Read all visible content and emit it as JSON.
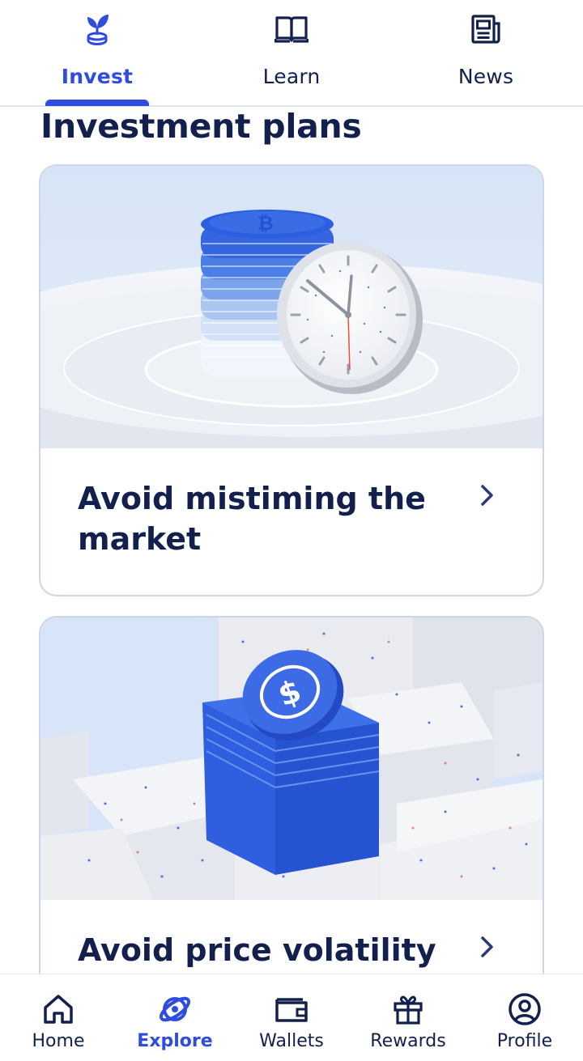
{
  "top_tabs": [
    {
      "label": "Invest",
      "icon": "seedling-coin-icon",
      "active": true
    },
    {
      "label": "Learn",
      "icon": "open-book-icon",
      "active": false
    },
    {
      "label": "News",
      "icon": "newspaper-icon",
      "active": false
    }
  ],
  "section_title": "Investment plans",
  "cards": [
    {
      "title": "Avoid mistiming the market",
      "image": "coin-stack-and-clock"
    },
    {
      "title": "Avoid price volatility",
      "image": "usdc-coin-on-blocks"
    }
  ],
  "bottom_nav": [
    {
      "label": "Home",
      "icon": "home-icon",
      "active": false
    },
    {
      "label": "Explore",
      "icon": "explore-icon",
      "active": true
    },
    {
      "label": "Wallets",
      "icon": "wallet-icon",
      "active": false
    },
    {
      "label": "Rewards",
      "icon": "gift-icon",
      "active": false
    },
    {
      "label": "Profile",
      "icon": "profile-icon",
      "active": false
    }
  ],
  "colors": {
    "accent": "#2f4ce0",
    "text": "#13204e",
    "card_border": "#cdd6e8",
    "image_bg": "#dbe6f7"
  }
}
